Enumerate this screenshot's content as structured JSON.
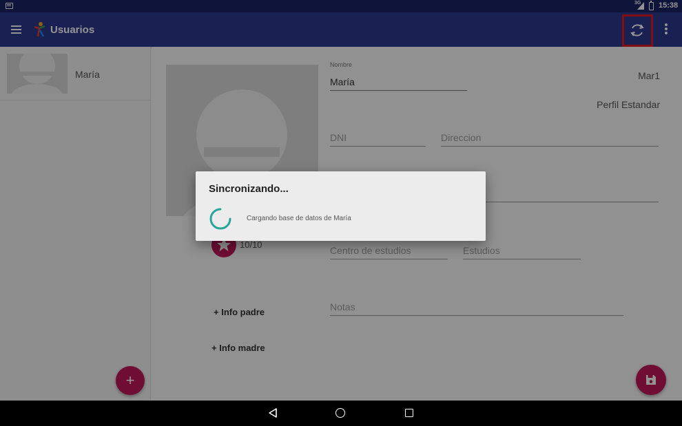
{
  "status_bar": {
    "network": "3G",
    "time": "15:38"
  },
  "app_bar": {
    "title": "Usuarios",
    "menu_icon": "menu-icon",
    "sync_icon": "sync-icon",
    "overflow_icon": "more-vert-icon",
    "color": "#2b3990"
  },
  "user_list": {
    "items": [
      {
        "name": "María"
      }
    ],
    "add_icon": "+"
  },
  "detail": {
    "nombre_label": "Nombre",
    "nombre_value": "María",
    "user_code": "Mar1",
    "profile": "Perfil Estandar",
    "dni_placeholder": "DNI",
    "direccion_placeholder": "Direccion",
    "rating": "10/10",
    "centro_placeholder": "Centro de estudios",
    "estudios_placeholder": "Estudios",
    "notas_placeholder": "Notas",
    "info_padre": "+ Info padre",
    "info_madre": "+ Info madre"
  },
  "dialog": {
    "title": "Sincronizando...",
    "message": "Cargando base de datos de María",
    "spinner_color": "#26a69a"
  },
  "accent_color": "#c2185b",
  "highlight_color": "#e0191f"
}
